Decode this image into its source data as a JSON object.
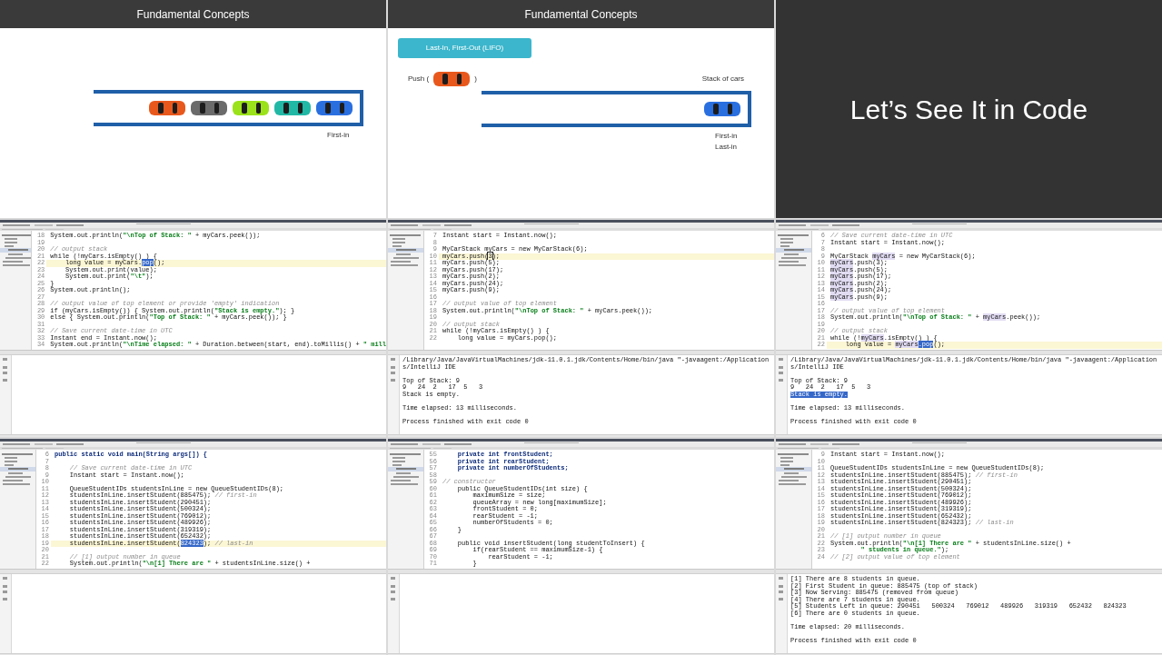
{
  "frames": [
    {
      "kind": "slide",
      "title": "Fundamental Concepts",
      "track_cars": [
        {
          "color": "#e8581c"
        },
        {
          "color": "#6b6b6b"
        },
        {
          "color": "#9be21a"
        },
        {
          "color": "#22b8a6"
        },
        {
          "color": "#2a6fe0"
        }
      ],
      "track_labels": [
        "First-in"
      ]
    },
    {
      "kind": "slide",
      "title": "Fundamental Concepts",
      "badge": "Last-In, First-Out (LIFO)",
      "push_open": "Push (",
      "push_car": {
        "color": "#e8581c"
      },
      "push_close": ")",
      "stack_label": "Stack of cars",
      "track_cars": [
        {
          "color": "#2a6fe0"
        }
      ],
      "track_labels": [
        "First-in",
        "Last-in"
      ]
    },
    {
      "kind": "title_slide",
      "text": "Let’s See It in Code"
    },
    {
      "kind": "ide",
      "lines": [
        {
          "num": "18",
          "current": false,
          "parts": [
            {
              "text": "System.out.println(",
              "kind": "code"
            },
            {
              "text": "\"\\nTop of Stack: \"",
              "kind": "string"
            },
            {
              "text": " + myCars.peek());",
              "kind": "code"
            }
          ]
        },
        {
          "num": "19",
          "current": false
        },
        {
          "num": "20",
          "current": false,
          "parts": [
            {
              "text": "// output stack",
              "kind": "comment"
            }
          ]
        },
        {
          "num": "21",
          "current": false,
          "parts": [
            {
              "text": "while (!myCars.isEmpty() ) {",
              "kind": "code"
            }
          ]
        },
        {
          "num": "22",
          "current": true,
          "parts": [
            {
              "text": "    long value = myCars.",
              "kind": "code"
            },
            {
              "text": "pop",
              "kind": "selected"
            },
            {
              "text": "();",
              "kind": "code"
            }
          ]
        },
        {
          "num": "23",
          "current": false,
          "parts": [
            {
              "text": "    System.out.print(value);",
              "kind": "code"
            }
          ]
        },
        {
          "num": "24",
          "current": false,
          "parts": [
            {
              "text": "    System.out.print(",
              "kind": "code"
            },
            {
              "text": "\"\\t\"",
              "kind": "string"
            },
            {
              "text": ");",
              "kind": "code"
            }
          ]
        },
        {
          "num": "25",
          "current": false,
          "parts": [
            {
              "text": "}",
              "kind": "code"
            }
          ]
        },
        {
          "num": "26",
          "current": false,
          "parts": [
            {
              "text": "System.out.println();",
              "kind": "code"
            }
          ]
        },
        {
          "num": "27",
          "current": false
        },
        {
          "num": "28",
          "current": false,
          "parts": [
            {
              "text": "// output value of top element or provide 'empty' indication",
              "kind": "comment"
            }
          ]
        },
        {
          "num": "29",
          "current": false,
          "parts": [
            {
              "text": "if (myCars.isEmpty()) { System.out.println(",
              "kind": "code"
            },
            {
              "text": "\"Stack is empty.\"",
              "kind": "string"
            },
            {
              "text": "); }",
              "kind": "code"
            }
          ]
        },
        {
          "num": "30",
          "current": false,
          "parts": [
            {
              "text": "else { System.out.println(",
              "kind": "code"
            },
            {
              "text": "\"Top of Stack: \"",
              "kind": "string"
            },
            {
              "text": " + myCars.peek()); }",
              "kind": "code"
            }
          ]
        },
        {
          "num": "31",
          "current": false
        },
        {
          "num": "32",
          "current": false,
          "parts": [
            {
              "text": "// Save current date-time in UTC",
              "kind": "comment"
            }
          ]
        },
        {
          "num": "33",
          "current": false,
          "parts": [
            {
              "text": "Instant end = Instant.now();",
              "kind": "code"
            }
          ]
        },
        {
          "num": "34",
          "current": false,
          "parts": [
            {
              "text": "System.out.println(",
              "kind": "code"
            },
            {
              "text": "\"\\nTime elapsed: \"",
              "kind": "string"
            },
            {
              "text": " + Duration.between(start, end).toMillis() + ",
              "kind": "code"
            },
            {
              "text": "\" mill",
              "kind": "string"
            }
          ]
        }
      ]
    },
    {
      "kind": "ide",
      "lines": [
        {
          "num": "7",
          "current": false,
          "parts": [
            {
              "text": "Instant start = Instant.now();",
              "kind": "code"
            }
          ]
        },
        {
          "num": "8",
          "current": false
        },
        {
          "num": "9",
          "current": false,
          "parts": [
            {
              "text": "MyCarStack myCars = new MyCarStack(6);",
              "kind": "code"
            }
          ]
        },
        {
          "num": "10",
          "current": true,
          "parts": [
            {
              "text": "myCars.push(",
              "kind": "code"
            },
            {
              "text": "3",
              "kind": "cursor"
            },
            {
              "text": ");",
              "kind": "code"
            }
          ]
        },
        {
          "num": "11",
          "current": false,
          "parts": [
            {
              "text": "myCars.push(5);",
              "kind": "code"
            }
          ]
        },
        {
          "num": "12",
          "current": false,
          "parts": [
            {
              "text": "myCars.push(17);",
              "kind": "code"
            }
          ]
        },
        {
          "num": "13",
          "current": false,
          "parts": [
            {
              "text": "myCars.push(2);",
              "kind": "code"
            }
          ]
        },
        {
          "num": "14",
          "current": false,
          "parts": [
            {
              "text": "myCars.push(24);",
              "kind": "code"
            }
          ]
        },
        {
          "num": "15",
          "current": false,
          "parts": [
            {
              "text": "myCars.push(9);",
              "kind": "code"
            }
          ]
        },
        {
          "num": "16",
          "current": false
        },
        {
          "num": "17",
          "current": false,
          "parts": [
            {
              "text": "// output value of top element",
              "kind": "comment"
            }
          ]
        },
        {
          "num": "18",
          "current": false,
          "parts": [
            {
              "text": "System.out.println(",
              "kind": "code"
            },
            {
              "text": "\"\\nTop of Stack: \"",
              "kind": "string"
            },
            {
              "text": " + myCars.peek());",
              "kind": "code"
            }
          ]
        },
        {
          "num": "19",
          "current": false
        },
        {
          "num": "20",
          "current": false,
          "parts": [
            {
              "text": "// output stack",
              "kind": "comment"
            }
          ]
        },
        {
          "num": "21",
          "current": false,
          "parts": [
            {
              "text": "while (!myCars.isEmpty() ) {",
              "kind": "code"
            }
          ]
        },
        {
          "num": "22",
          "current": false,
          "parts": [
            {
              "text": "    long value = myCars.pop();",
              "kind": "code"
            }
          ]
        }
      ],
      "console": [
        {
          "lines": [
            {
              "text": "/Library/Java/JavaVirtualMachines/jdk-11.0.1.jdk/Contents/Home/bin/java \"-javaagent:/Applications/IntelliJ IDE",
              "selected": false
            }
          ]
        },
        {
          "lines": [
            {
              "text": "Top of Stack: 9",
              "selected": false
            },
            {
              "text": "9   24  2   17  5   3",
              "selected": false
            },
            {
              "text": "Stack is empty.",
              "selected": false
            }
          ]
        },
        {
          "lines": [
            {
              "text": "Time elapsed: 13 milliseconds.",
              "selected": false
            }
          ]
        },
        {
          "lines": [
            {
              "text": "Process finished with exit code 0",
              "selected": false
            }
          ]
        }
      ]
    },
    {
      "kind": "ide",
      "lines": [
        {
          "num": "6",
          "current": false,
          "parts": [
            {
              "text": "// Save current date-time in UTC",
              "kind": "comment"
            }
          ]
        },
        {
          "num": "7",
          "current": false,
          "parts": [
            {
              "text": "Instant start = Instant.now();",
              "kind": "code"
            }
          ]
        },
        {
          "num": "8",
          "current": false
        },
        {
          "num": "9",
          "current": false,
          "parts": [
            {
              "text": "MyCarStack ",
              "kind": "code"
            },
            {
              "text": "myCars",
              "kind": "ref"
            },
            {
              "text": " = new MyCarStack(6);",
              "kind": "code"
            }
          ]
        },
        {
          "num": "10",
          "current": false,
          "parts": [
            {
              "text": "myCars",
              "kind": "ref"
            },
            {
              "text": ".push(3);",
              "kind": "code"
            }
          ]
        },
        {
          "num": "11",
          "current": false,
          "parts": [
            {
              "text": "myCars",
              "kind": "ref"
            },
            {
              "text": ".push(5);",
              "kind": "code"
            }
          ]
        },
        {
          "num": "12",
          "current": false,
          "parts": [
            {
              "text": "myCars",
              "kind": "ref"
            },
            {
              "text": ".push(17);",
              "kind": "code"
            }
          ]
        },
        {
          "num": "13",
          "current": false,
          "parts": [
            {
              "text": "myCars",
              "kind": "ref"
            },
            {
              "text": ".push(2);",
              "kind": "code"
            }
          ]
        },
        {
          "num": "14",
          "current": false,
          "parts": [
            {
              "text": "myCars",
              "kind": "ref"
            },
            {
              "text": ".push(24);",
              "kind": "code"
            }
          ]
        },
        {
          "num": "15",
          "current": false,
          "parts": [
            {
              "text": "myCars",
              "kind": "ref"
            },
            {
              "text": ".push(9);",
              "kind": "code"
            }
          ]
        },
        {
          "num": "16",
          "current": false
        },
        {
          "num": "17",
          "current": false,
          "parts": [
            {
              "text": "// output value of top element",
              "kind": "comment"
            }
          ]
        },
        {
          "num": "18",
          "current": false,
          "parts": [
            {
              "text": "System.out.println(",
              "kind": "code"
            },
            {
              "text": "\"\\nTop of Stack: \"",
              "kind": "string"
            },
            {
              "text": " + ",
              "kind": "code"
            },
            {
              "text": "myCars",
              "kind": "ref"
            },
            {
              "text": ".peek());",
              "kind": "code"
            }
          ]
        },
        {
          "num": "19",
          "current": false
        },
        {
          "num": "20",
          "current": false,
          "parts": [
            {
              "text": "// output stack",
              "kind": "comment"
            }
          ]
        },
        {
          "num": "21",
          "current": false,
          "parts": [
            {
              "text": "while (!",
              "kind": "code"
            },
            {
              "text": "myCars",
              "kind": "ref"
            },
            {
              "text": ".isEmpty() ) {",
              "kind": "code"
            }
          ]
        },
        {
          "num": "22",
          "current": true,
          "parts": [
            {
              "text": "    long value = ",
              "kind": "code"
            },
            {
              "text": "myCars",
              "kind": "ref"
            },
            {
              "text": ".pop",
              "kind": "selected"
            },
            {
              "text": "();",
              "kind": "code"
            }
          ]
        }
      ],
      "console": [
        {
          "lines": [
            {
              "text": "/Library/Java/JavaVirtualMachines/jdk-11.0.1.jdk/Contents/Home/bin/java \"-javaagent:/Applications/IntelliJ IDE",
              "selected": false
            }
          ]
        },
        {
          "lines": [
            {
              "text": "Top of Stack: 9",
              "selected": false
            },
            {
              "text": "9   24  2   17  5   3",
              "selected": false
            },
            {
              "text": "Stack is empty.",
              "selected": true
            }
          ]
        },
        {
          "lines": [
            {
              "text": "Time elapsed: 13 milliseconds.",
              "selected": false
            }
          ]
        },
        {
          "lines": [
            {
              "text": "Process finished with exit code 0",
              "selected": false
            }
          ]
        }
      ]
    },
    {
      "kind": "ide",
      "lines": [
        {
          "num": "6",
          "current": false,
          "parts": [
            {
              "text": "public static void main(String args[]) {",
              "kind": "keyword"
            }
          ]
        },
        {
          "num": "7",
          "current": false
        },
        {
          "num": "8",
          "current": false,
          "parts": [
            {
              "text": "    // Save current date-time in UTC",
              "kind": "comment"
            }
          ]
        },
        {
          "num": "9",
          "current": false,
          "parts": [
            {
              "text": "    Instant start = Instant.now();",
              "kind": "code"
            }
          ]
        },
        {
          "num": "10",
          "current": false
        },
        {
          "num": "11",
          "current": false,
          "parts": [
            {
              "text": "    QueueStudentIDs studentsInLine = new QueueStudentIDs(8);",
              "kind": "code"
            }
          ]
        },
        {
          "num": "12",
          "current": false,
          "parts": [
            {
              "text": "    studentsInLine.insertStudent(885475); ",
              "kind": "code"
            },
            {
              "text": "// first-in",
              "kind": "comment"
            }
          ]
        },
        {
          "num": "13",
          "current": false,
          "parts": [
            {
              "text": "    studentsInLine.insertStudent(290451);",
              "kind": "code"
            }
          ]
        },
        {
          "num": "14",
          "current": false,
          "parts": [
            {
              "text": "    studentsInLine.insertStudent(500324);",
              "kind": "code"
            }
          ]
        },
        {
          "num": "15",
          "current": false,
          "parts": [
            {
              "text": "    studentsInLine.insertStudent(769012);",
              "kind": "code"
            }
          ]
        },
        {
          "num": "16",
          "current": false,
          "parts": [
            {
              "text": "    studentsInLine.insertStudent(489926);",
              "kind": "code"
            }
          ]
        },
        {
          "num": "17",
          "current": false,
          "parts": [
            {
              "text": "    studentsInLine.insertStudent(319319);",
              "kind": "code"
            }
          ]
        },
        {
          "num": "18",
          "current": false,
          "parts": [
            {
              "text": "    studentsInLine.insertStudent(652432);",
              "kind": "code"
            }
          ]
        },
        {
          "num": "19",
          "current": true,
          "parts": [
            {
              "text": "    studentsInLine.insertStudent(",
              "kind": "code"
            },
            {
              "text": "824323",
              "kind": "selected"
            },
            {
              "text": "); ",
              "kind": "code"
            },
            {
              "text": "// last-in",
              "kind": "comment"
            }
          ]
        },
        {
          "num": "20",
          "current": false
        },
        {
          "num": "21",
          "current": false,
          "parts": [
            {
              "text": "    // [1] output number in queue",
              "kind": "comment"
            }
          ]
        },
        {
          "num": "22",
          "current": false,
          "parts": [
            {
              "text": "    System.out.println(",
              "kind": "code"
            },
            {
              "text": "\"\\n[1] There are \"",
              "kind": "string"
            },
            {
              "text": " + studentsInLine.size() +",
              "kind": "code"
            }
          ]
        }
      ]
    },
    {
      "kind": "ide",
      "lines": [
        {
          "num": "55",
          "current": false,
          "parts": [
            {
              "text": "    private int frontStudent;",
              "kind": "keyword"
            }
          ]
        },
        {
          "num": "56",
          "current": false,
          "parts": [
            {
              "text": "    private int rearStudent;",
              "kind": "keyword"
            }
          ]
        },
        {
          "num": "57",
          "current": false,
          "parts": [
            {
              "text": "    private int numberOfStudents;",
              "kind": "keyword"
            }
          ]
        },
        {
          "num": "58",
          "current": false
        },
        {
          "num": "59",
          "current": false,
          "parts": [
            {
              "text": "// constructor",
              "kind": "comment"
            }
          ]
        },
        {
          "num": "60",
          "current": false,
          "parts": [
            {
              "text": "    public QueueStudentIDs(int size) {",
              "kind": "code"
            }
          ]
        },
        {
          "num": "61",
          "current": false,
          "parts": [
            {
              "text": "        maximumSize = size;",
              "kind": "code"
            }
          ]
        },
        {
          "num": "62",
          "current": false,
          "parts": [
            {
              "text": "        queueArray = new long[maximumSize];",
              "kind": "code"
            }
          ]
        },
        {
          "num": "63",
          "current": false,
          "parts": [
            {
              "text": "        frontStudent = 0;",
              "kind": "code"
            }
          ]
        },
        {
          "num": "64",
          "current": false,
          "parts": [
            {
              "text": "        rearStudent = -1;",
              "kind": "code"
            }
          ]
        },
        {
          "num": "65",
          "current": false,
          "parts": [
            {
              "text": "        numberOfStudents = 0;",
              "kind": "code"
            }
          ]
        },
        {
          "num": "66",
          "current": false,
          "parts": [
            {
              "text": "    }",
              "kind": "code"
            }
          ]
        },
        {
          "num": "67",
          "current": false
        },
        {
          "num": "68",
          "current": false,
          "parts": [
            {
              "text": "    public void insertStudent(long studentToInsert) {",
              "kind": "code"
            }
          ]
        },
        {
          "num": "69",
          "current": false,
          "parts": [
            {
              "text": "        if(rearStudent == maximumSize-1) {",
              "kind": "code"
            }
          ]
        },
        {
          "num": "70",
          "current": false,
          "parts": [
            {
              "text": "            rearStudent = -1;",
              "kind": "code"
            }
          ]
        },
        {
          "num": "71",
          "current": false,
          "parts": [
            {
              "text": "        }",
              "kind": "code"
            }
          ]
        }
      ]
    },
    {
      "kind": "ide",
      "lines": [
        {
          "num": "9",
          "current": false,
          "parts": [
            {
              "text": "Instant start = Instant.now();",
              "kind": "code"
            }
          ]
        },
        {
          "num": "10",
          "current": false
        },
        {
          "num": "11",
          "current": false,
          "parts": [
            {
              "text": "QueueStudentIDs studentsInLine = new QueueStudentIDs(8);",
              "kind": "code"
            }
          ]
        },
        {
          "num": "12",
          "current": false,
          "parts": [
            {
              "text": "studentsInLine.insertStudent(885475); ",
              "kind": "code"
            },
            {
              "text": "// first-in",
              "kind": "comment"
            }
          ]
        },
        {
          "num": "13",
          "current": false,
          "parts": [
            {
              "text": "studentsInLine.insertStudent(290451);",
              "kind": "code"
            }
          ]
        },
        {
          "num": "14",
          "current": false,
          "parts": [
            {
              "text": "studentsInLine.insertStudent(500324);",
              "kind": "code"
            }
          ]
        },
        {
          "num": "15",
          "current": false,
          "parts": [
            {
              "text": "studentsInLine.insertStudent(769012);",
              "kind": "code"
            }
          ]
        },
        {
          "num": "16",
          "current": false,
          "parts": [
            {
              "text": "studentsInLine.insertStudent(489926);",
              "kind": "code"
            }
          ]
        },
        {
          "num": "17",
          "current": false,
          "parts": [
            {
              "text": "studentsInLine.insertStudent(319319);",
              "kind": "code"
            }
          ]
        },
        {
          "num": "18",
          "current": false,
          "parts": [
            {
              "text": "studentsInLine.insertStudent(652432);",
              "kind": "code"
            }
          ]
        },
        {
          "num": "19",
          "current": false,
          "parts": [
            {
              "text": "studentsInLine.insertStudent(824323); ",
              "kind": "code"
            },
            {
              "text": "// last-in",
              "kind": "comment"
            }
          ]
        },
        {
          "num": "20",
          "current": false
        },
        {
          "num": "21",
          "current": false,
          "parts": [
            {
              "text": "// [1] output number in queue",
              "kind": "comment"
            }
          ]
        },
        {
          "num": "22",
          "current": false,
          "parts": [
            {
              "text": "System.out.println(",
              "kind": "code"
            },
            {
              "text": "\"\\n[1] There are \"",
              "kind": "string"
            },
            {
              "text": " + studentsInLine.size() +",
              "kind": "code"
            }
          ]
        },
        {
          "num": "23",
          "current": false,
          "parts": [
            {
              "text": "        \" students in queue.\"",
              "kind": "string"
            },
            {
              "text": ");",
              "kind": "code"
            }
          ]
        },
        {
          "num": "24",
          "current": false,
          "parts": [
            {
              "text": "// [2] output value of top element",
              "kind": "comment"
            }
          ]
        }
      ],
      "console": [
        {
          "lines": [
            {
              "text": "[1] There are 8 students in queue.",
              "selected": false
            },
            {
              "text": "[2] First Student in queue: 885475 (top of stack)",
              "selected": false
            },
            {
              "text": "[3] Now Serving: 885475 (removed from queue)",
              "selected": false
            },
            {
              "text": "[4] There are 7 students in queue.",
              "selected": false
            },
            {
              "text": "[5] Students Left in queue: 290451   500324   769012   489926   319319   652432   824323",
              "selected": false
            },
            {
              "text": "[6] There are 0 students in queue.",
              "selected": false
            }
          ]
        },
        {
          "lines": [
            {
              "text": "Time elapsed: 20 milliseconds.",
              "selected": false
            }
          ]
        },
        {
          "lines": [
            {
              "text": "Process finished with exit code 0",
              "selected": false
            }
          ]
        }
      ]
    }
  ]
}
